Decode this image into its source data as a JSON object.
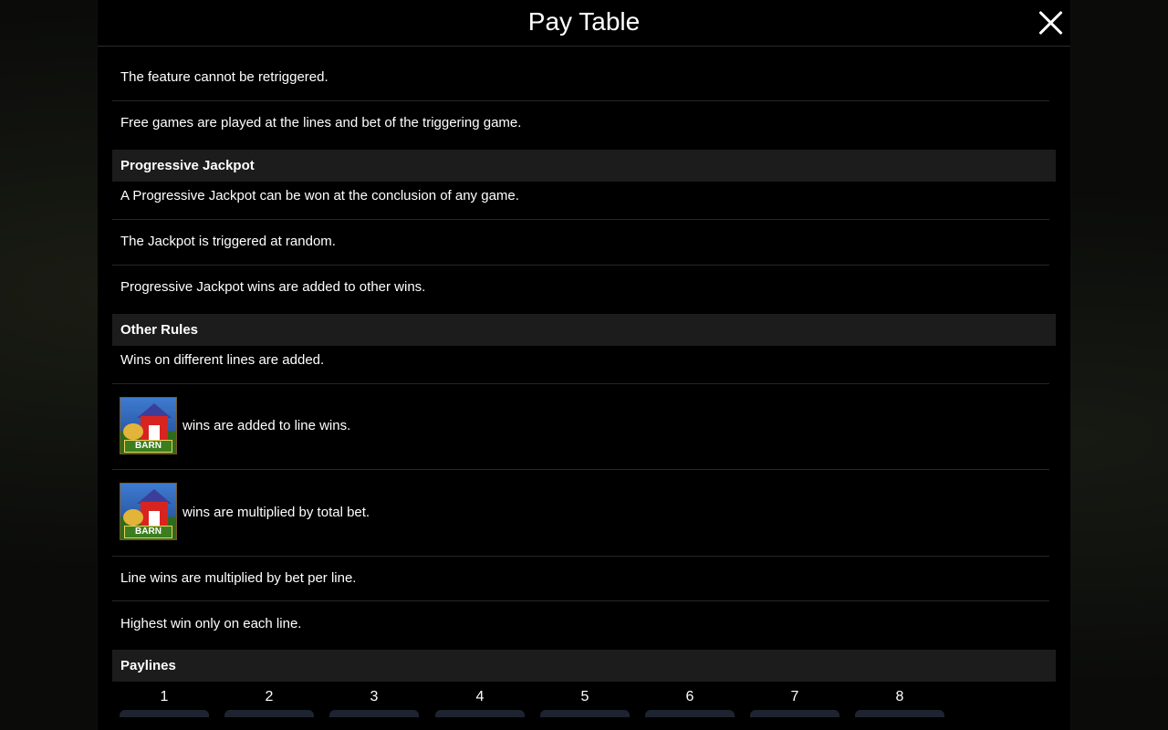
{
  "header": {
    "title": "Pay Table"
  },
  "sections": {
    "progressive": "Progressive Jackpot",
    "other": "Other Rules",
    "paylines": "Paylines"
  },
  "rows": {
    "r1": "The feature cannot be retriggered.",
    "r2": "Free games are played at the lines and bet of the triggering game.",
    "r3": "A Progressive Jackpot can be won at the conclusion of any game.",
    "r4": "The Jackpot is triggered at random.",
    "r5": "Progressive Jackpot wins are added to other wins.",
    "r6": "Wins on different lines are added.",
    "r7": "wins are added to line wins.",
    "r8": "wins are multiplied by total bet.",
    "r9": "Line wins are multiplied by bet per line.",
    "r10": "Highest win only on each line."
  },
  "symbol": {
    "label": "BARN"
  },
  "paylines": [
    "1",
    "2",
    "3",
    "4",
    "5",
    "6",
    "7",
    "8"
  ]
}
